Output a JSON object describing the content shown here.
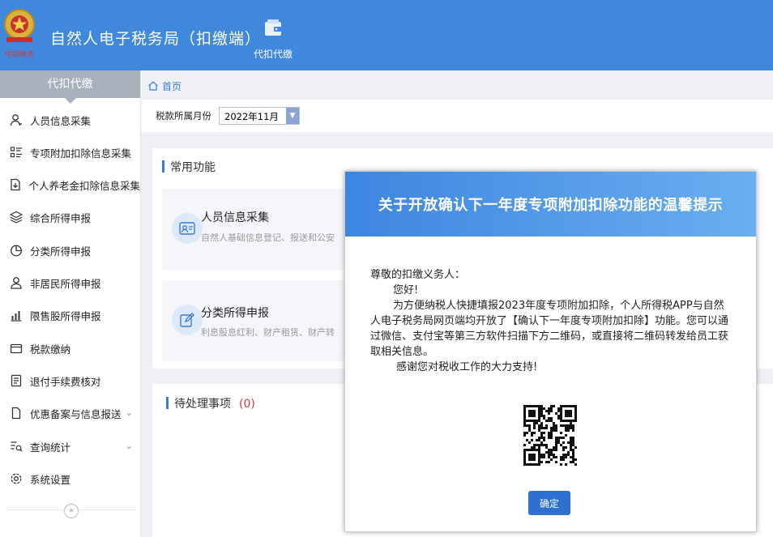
{
  "header": {
    "title": "自然人电子税务局（扣缴端）",
    "tab_label": "代扣代缴"
  },
  "sidebar": {
    "heading": "代扣代缴",
    "items": [
      {
        "label": "人员信息采集",
        "icon": "person-icon"
      },
      {
        "label": "专项附加扣除信息采集",
        "icon": "list-icon"
      },
      {
        "label": "个人养老金扣除信息采集",
        "icon": "document-download-icon"
      },
      {
        "label": "综合所得申报",
        "icon": "layers-icon"
      },
      {
        "label": "分类所得申报",
        "icon": "pie-chart-icon"
      },
      {
        "label": "非居民所得申报",
        "icon": "person-outline-icon"
      },
      {
        "label": "限售股所得申报",
        "icon": "bar-chart-icon"
      },
      {
        "label": "税款缴纳",
        "icon": "wallet-icon"
      },
      {
        "label": "退付手续费核对",
        "icon": "receipt-icon"
      },
      {
        "label": "优惠备案与信息报送",
        "icon": "file-icon",
        "expandable": true
      },
      {
        "label": "查询统计",
        "icon": "search-list-icon",
        "expandable": true
      },
      {
        "label": "系统设置",
        "icon": "gear-icon"
      }
    ],
    "collapse_label": "«"
  },
  "breadcrumb": {
    "home": "首页"
  },
  "toolbar": {
    "period_label": "税款所属月份",
    "period_value": "2022年11月"
  },
  "common": {
    "title": "常用功能",
    "cards": [
      {
        "title": "人员信息采集",
        "desc": "自然人基础信息登记、报送和公安"
      },
      {
        "title": "分类所得申报",
        "desc": "利息股息红利、财产租赁、财产转"
      }
    ]
  },
  "pending": {
    "title": "待处理事项",
    "count": "(0)"
  },
  "modal": {
    "title": "关于开放确认下一年度专项附加扣除功能的温馨提示",
    "greeting": "尊敬的扣缴义务人：",
    "hello": "您好!",
    "body": "为方便纳税人快捷填报2023年度专项附加扣除，个人所得税APP与自然人电子税务局网页端均开放了【确认下一年度专项附加扣除】功能。您可以通过微信、支付宝等第三方软件扫描下方二维码，或直接将二维码转发给员工获取相关信息。",
    "thanks": "感谢您对税收工作的大力支持!",
    "ok_label": "确定"
  },
  "colors": {
    "brand": "#3f88dc",
    "accent": "#2e6fd0",
    "danger": "#d9363e"
  }
}
